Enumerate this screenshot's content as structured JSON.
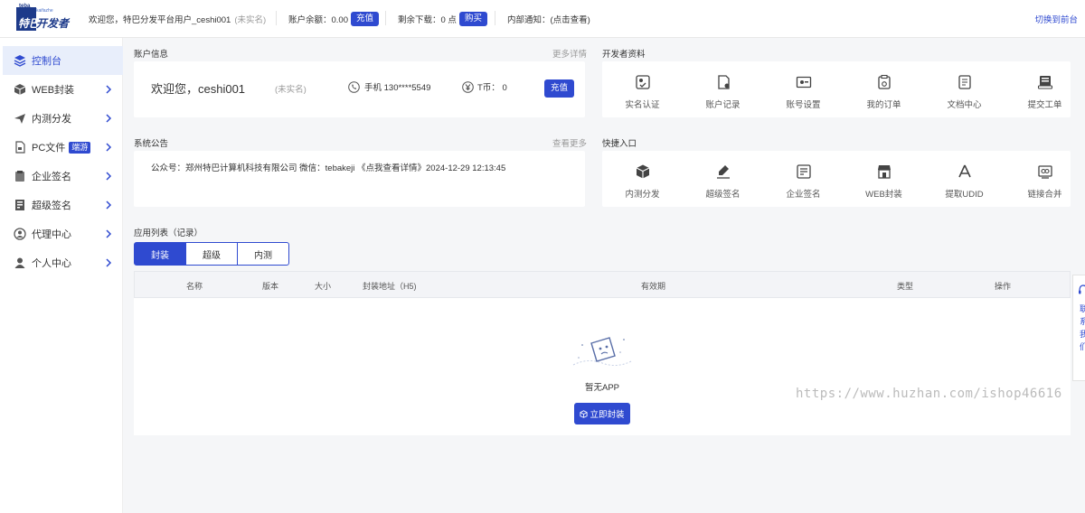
{
  "brand": {
    "small": "teba",
    "small2": "kaifazhe",
    "main_white": "特巴",
    "main_blue": "开发者"
  },
  "topbar": {
    "welcome": "欢迎您，特巴分发平台用户_ceshi001",
    "unverified": "(未实名)",
    "balance_label": "账户余额：0.00",
    "recharge": "充值",
    "downloads_label": "剩余下载：0 点",
    "buy": "购买",
    "notice_label": "内部通知：(点击查看)",
    "switch": "切换到前台"
  },
  "sidebar": {
    "items": [
      {
        "label": "控制台",
        "icon": "layers-icon"
      },
      {
        "label": "WEB封装",
        "icon": "cube-icon"
      },
      {
        "label": "内测分发",
        "icon": "paper-plane-icon"
      },
      {
        "label": "PC文件",
        "icon": "file-icon",
        "badge": "端游"
      },
      {
        "label": "企业签名",
        "icon": "clipboard-icon"
      },
      {
        "label": "超级签名",
        "icon": "certificate-icon"
      },
      {
        "label": "代理中心",
        "icon": "agent-icon"
      },
      {
        "label": "个人中心",
        "icon": "user-icon"
      }
    ]
  },
  "account": {
    "title": "账户信息",
    "more": "更多详情",
    "welcome": "欢迎您，ceshi001",
    "unverified": "(未实名)",
    "phone": "手机 130****5549",
    "coin": "T币： 0",
    "recharge": "充值"
  },
  "devinfo": {
    "title": "开发者资料",
    "items": [
      "实名认证",
      "账户记录",
      "账号设置",
      "我的订单",
      "文档中心",
      "提交工单"
    ]
  },
  "notice": {
    "title": "系统公告",
    "more": "查看更多",
    "text": "公众号：郑州特巴计算机科技有限公司 微信：tebakeji 《点我查看详情》2024-12-29 12:13:45"
  },
  "quick": {
    "title": "快捷入口",
    "items": [
      "内测分发",
      "超级签名",
      "企业签名",
      "WEB封装",
      "提取UDID",
      "链接合并"
    ]
  },
  "applist": {
    "title": "应用列表（记录）",
    "tabs": [
      "封装",
      "超级",
      "内测"
    ],
    "columns": [
      "名称",
      "版本",
      "大小",
      "封装地址（H5)",
      "有效期",
      "类型",
      "操作"
    ],
    "empty": "暂无APP",
    "empty_button": "立即封装"
  },
  "watermark": "https://www.huzhan.com/ishop46616",
  "float_tab": {
    "chars": [
      "联",
      "系",
      "我",
      "们"
    ]
  }
}
